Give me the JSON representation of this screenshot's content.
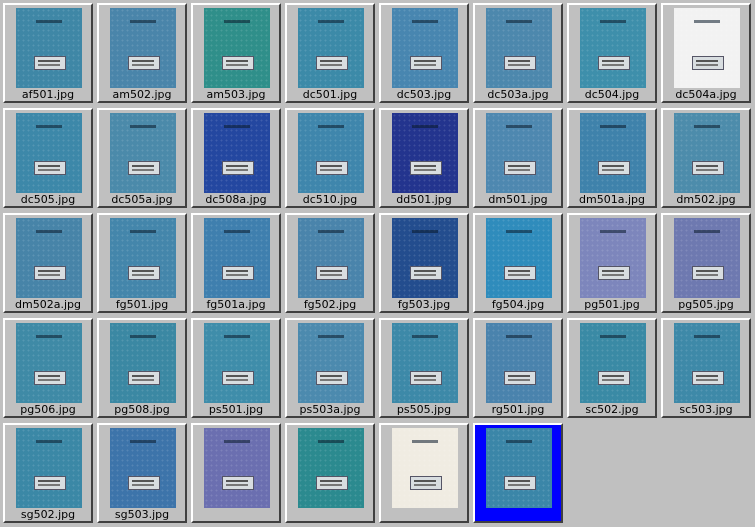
{
  "tiles": [
    {
      "label": "af501.jpg",
      "color": "#3f87a6"
    },
    {
      "label": "am502.jpg",
      "color": "#4a85aa"
    },
    {
      "label": "am503.jpg",
      "color": "#2f8f8a"
    },
    {
      "label": "dc501.jpg",
      "color": "#3c8aa8"
    },
    {
      "label": "dc503.jpg",
      "color": "#4886b0"
    },
    {
      "label": "dc503a.jpg",
      "color": "#4d88ad"
    },
    {
      "label": "dc504.jpg",
      "color": "#3e8fab"
    },
    {
      "label": "dc504a.jpg",
      "color": "#f2f2f2"
    },
    {
      "label": "dc505.jpg",
      "color": "#3d88a9"
    },
    {
      "label": "dc505a.jpg",
      "color": "#4b8aaa"
    },
    {
      "label": "dc508a.jpg",
      "color": "#2447a0"
    },
    {
      "label": "dc510.jpg",
      "color": "#3f86ac"
    },
    {
      "label": "dd501.jpg",
      "color": "#23348e"
    },
    {
      "label": "dm501.jpg",
      "color": "#4e88b0"
    },
    {
      "label": "dm501a.jpg",
      "color": "#3f82ab"
    },
    {
      "label": "dm502.jpg",
      "color": "#4d8cab"
    },
    {
      "label": "dm502a.jpg",
      "color": "#4784a8"
    },
    {
      "label": "fg501.jpg",
      "color": "#4486ab"
    },
    {
      "label": "fg501a.jpg",
      "color": "#3f7fae"
    },
    {
      "label": "fg502.jpg",
      "color": "#4a84ab"
    },
    {
      "label": "fg503.jpg",
      "color": "#234d8e"
    },
    {
      "label": "fg504.jpg",
      "color": "#2f8cbc"
    },
    {
      "label": "pg501.jpg",
      "color": "#7d86bc"
    },
    {
      "label": "pg505.jpg",
      "color": "#6e79b0"
    },
    {
      "label": "pg506.jpg",
      "color": "#3f8aa6"
    },
    {
      "label": "pg508.jpg",
      "color": "#3b88a3"
    },
    {
      "label": "ps501.jpg",
      "color": "#3f8daa"
    },
    {
      "label": "ps503a.jpg",
      "color": "#4c8aae"
    },
    {
      "label": "ps505.jpg",
      "color": "#3d89a8"
    },
    {
      "label": "rg501.jpg",
      "color": "#4a83ad"
    },
    {
      "label": "sc502.jpg",
      "color": "#3a8aa5"
    },
    {
      "label": "sc503.jpg",
      "color": "#3e89a8"
    },
    {
      "label": "sg502.jpg",
      "color": "#3b88a6"
    },
    {
      "label": "sg503.jpg",
      "color": "#3d74aa"
    },
    {
      "label": "",
      "color": "#6b6fb0"
    },
    {
      "label": "",
      "color": "#2b8a8f"
    },
    {
      "label": "",
      "color": "#f0ece2"
    },
    {
      "label": "",
      "color": "#3b86a8"
    }
  ],
  "selected_index": 37
}
